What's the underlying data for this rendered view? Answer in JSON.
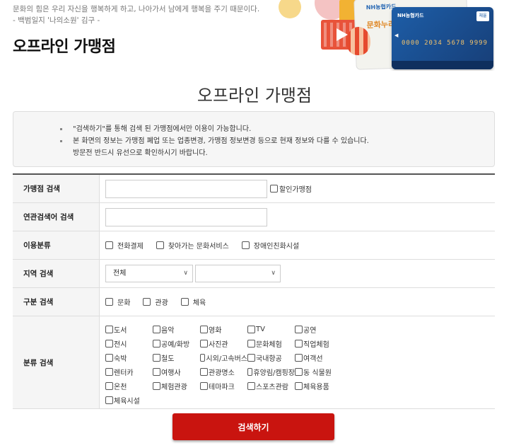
{
  "header": {
    "quote_line1": "문화의 힘은 우리 자신을 행복하게 하고, 나아가서 남에게 행복을 주기 때문이다.",
    "quote_line2": "- 백범일지 '나의소원' 김구 -",
    "page_title": "오프라인 가맹점"
  },
  "banner": {
    "back_card_brand": "NH농협카드",
    "back_card_text": "문화누리",
    "front_card_brand": "NH농협카드",
    "front_card_badge": "체율",
    "front_card_number": "0000 2034 5678 9999"
  },
  "section_title": "오프라인 가맹점",
  "notice": [
    "\"검색하기\"를 통해 검색 된 가맹점에서만 이용이 가능합니다.",
    "본 화면의 정보는 가맹점 폐업 또는 업종변경, 가맹점 정보변경 등으로 현재 정보와 다를 수 있습니다.",
    "방문전 반드시 유선으로 확인하시기 바랍니다."
  ],
  "form": {
    "store_search": {
      "label": "가맹점 검색",
      "value": "",
      "discount_label": "할인가맹점"
    },
    "related_search": {
      "label": "연관검색어 검색",
      "value": ""
    },
    "usage": {
      "label": "이용분류",
      "options": [
        "전화결제",
        "찾아가는 문화서비스",
        "장애인친화시설"
      ]
    },
    "region": {
      "label": "지역 검색",
      "primary": "전체",
      "secondary": ""
    },
    "type": {
      "label": "구분 검색",
      "options": [
        "문화",
        "관광",
        "체육"
      ]
    },
    "category": {
      "label": "분류 검색",
      "items": [
        "도서",
        "음악",
        "영화",
        "TV",
        "공연",
        "전시",
        "공예/화방",
        "사진관",
        "문화체험",
        "직업체험",
        "숙박",
        "철도",
        "시외/고속버스",
        "국내항공",
        "여객선",
        "렌터카",
        "여행사",
        "관광명소",
        "휴양림/캠핑장",
        "동 식물원",
        "온천",
        "체험관광",
        "테마파크",
        "스포츠관람",
        "체육용품",
        "체육시설"
      ]
    }
  },
  "search_button": "검색하기",
  "colors": {
    "button": "#c9140f",
    "card": "#1d5ea8"
  }
}
